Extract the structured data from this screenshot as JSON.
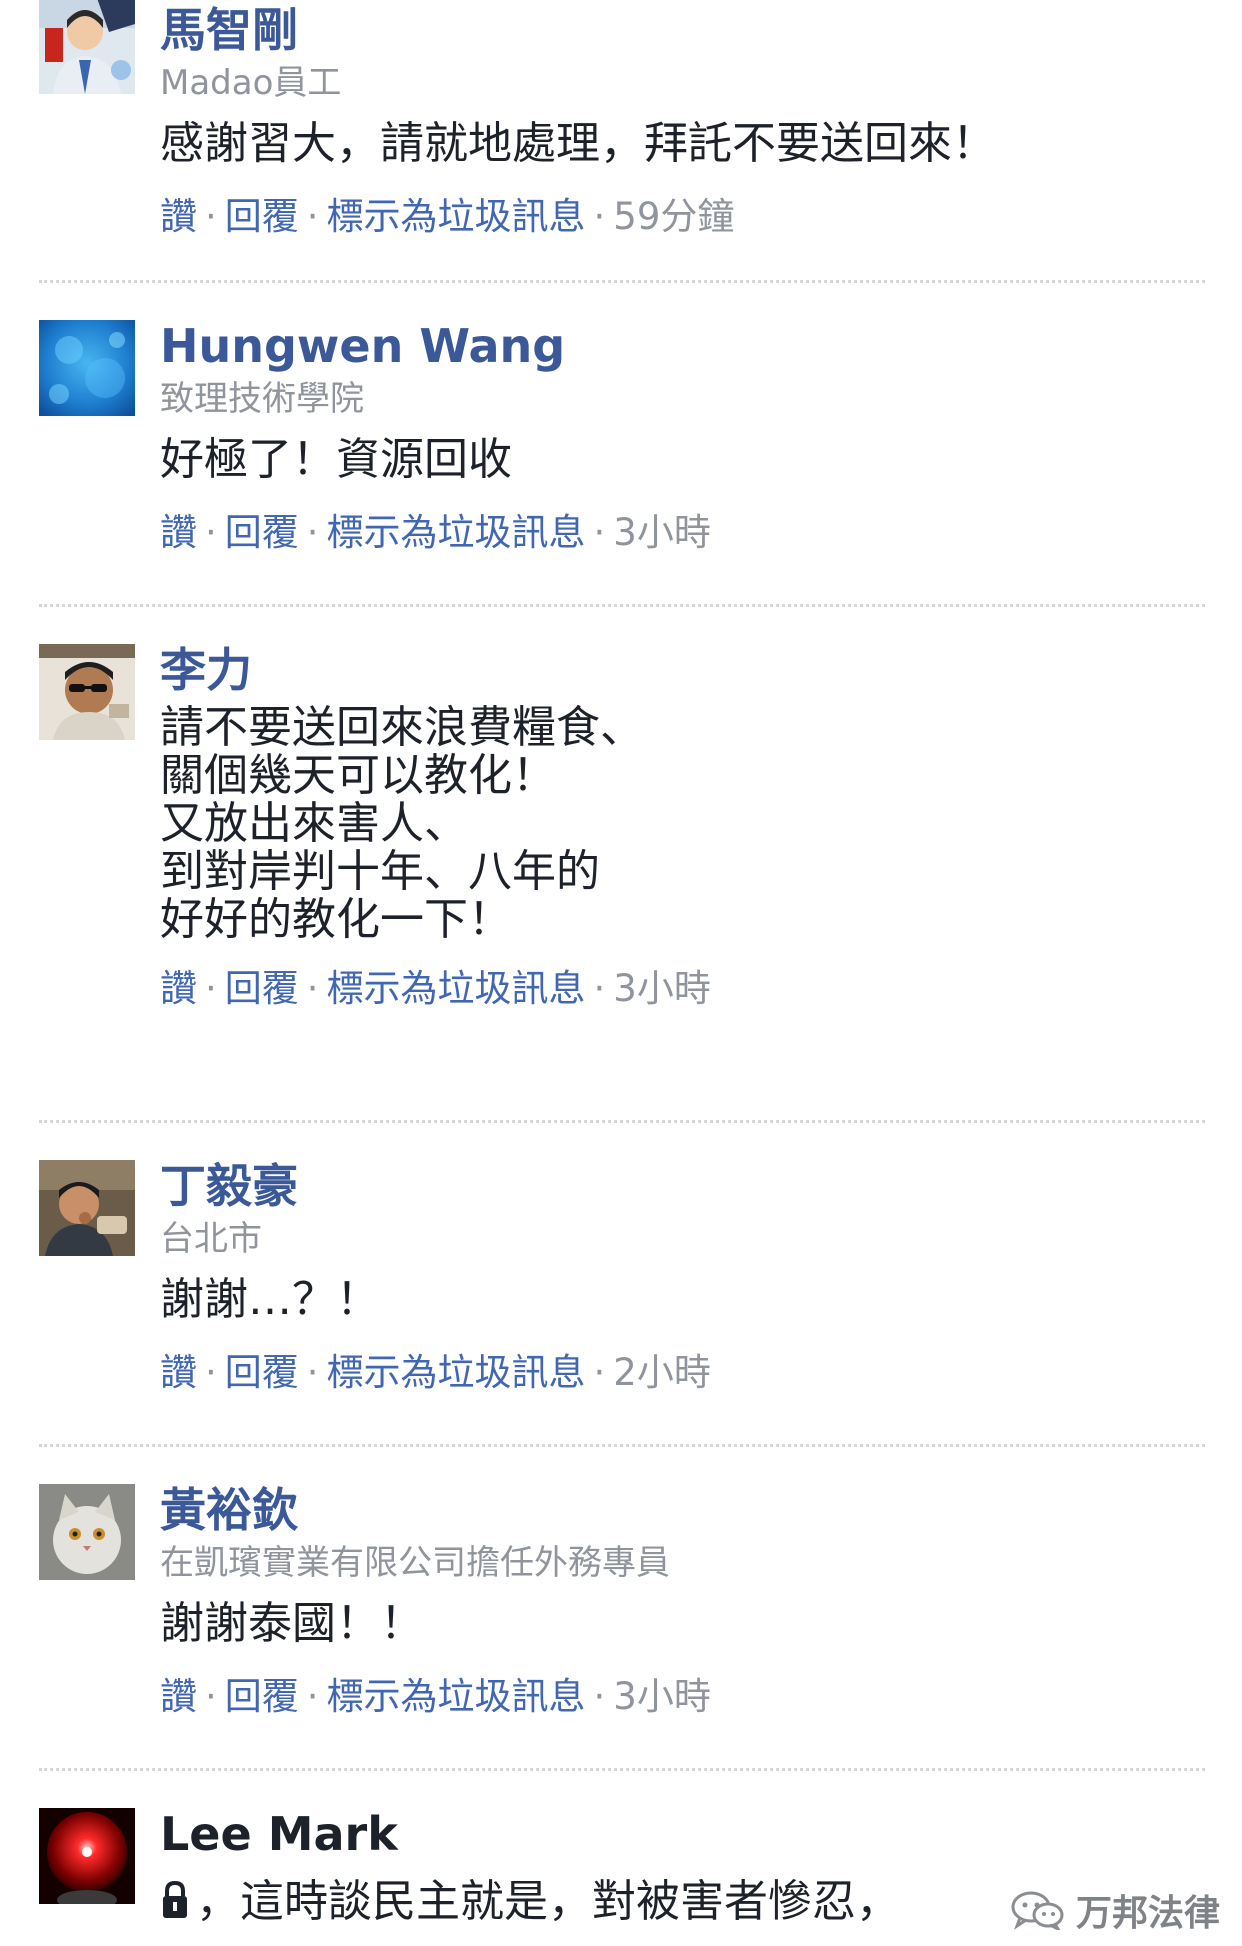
{
  "comments": [
    {
      "name": "馬智剛",
      "subtitle": "Madao員工",
      "text": [
        "感謝習大，請就地處理，拜託不要送回來！"
      ],
      "like": "讚",
      "reply": "回覆",
      "spam": "標示為垃圾訊息",
      "time": "59分鐘"
    },
    {
      "name": "Hungwen Wang",
      "subtitle": "致理技術學院",
      "text": [
        "好極了！資源回收"
      ],
      "like": "讚",
      "reply": "回覆",
      "spam": "標示為垃圾訊息",
      "time": "3小時"
    },
    {
      "name": "李力",
      "text": [
        "請不要送回來浪費糧食、",
        "關個幾天可以教化！",
        "又放出來害人、",
        "到對岸判十年、八年的",
        "好好的教化一下！"
      ],
      "like": "讚",
      "reply": "回覆",
      "spam": "標示為垃圾訊息",
      "time": "3小時"
    },
    {
      "name": "丁毅豪",
      "subtitle": "台北市",
      "text": [
        "謝謝…？！"
      ],
      "like": "讚",
      "reply": "回覆",
      "spam": "標示為垃圾訊息",
      "time": "2小時"
    },
    {
      "name": "黃裕欽",
      "subtitle": "在凱璸實業有限公司擔任外務專員",
      "text": [
        "謝謝泰國！！"
      ],
      "like": "讚",
      "reply": "回覆",
      "spam": "標示為垃圾訊息",
      "time": "3小時"
    },
    {
      "name": "Lee Mark",
      "text": [
        "，這時談民主就是，對被害者慘忍，"
      ]
    }
  ],
  "separator": "·",
  "watermark": "万邦法律",
  "colors": {
    "link": "#4267b2",
    "name": "#3b5998",
    "muted": "#90949c",
    "divider": "#d4d6da"
  },
  "icons": [
    "wechat-icon",
    "lock-icon"
  ]
}
